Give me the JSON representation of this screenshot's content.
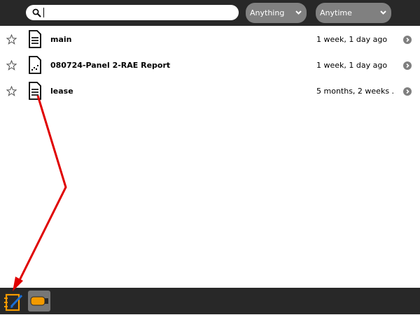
{
  "toolbar": {
    "search": {
      "value": "",
      "placeholder": ""
    },
    "filter_type": {
      "selected": "Anything"
    },
    "filter_time": {
      "selected": "Anytime"
    }
  },
  "journal": {
    "entries": [
      {
        "title": "main",
        "date": "1 week, 1 day ago",
        "icon": "text-document-icon",
        "starred": false
      },
      {
        "title": "080724-Panel 2-RAE Report",
        "date": "1 week, 1 day ago",
        "icon": "chart-document-icon",
        "starred": false
      },
      {
        "title": "lease",
        "date": "5 months, 2 weeks ...",
        "icon": "text-document-icon",
        "starred": false
      }
    ]
  },
  "frame": {
    "items": [
      {
        "name": "journal-icon",
        "color": "#f39a00"
      },
      {
        "name": "usb-drive-icon",
        "color": "#f39a00"
      }
    ]
  },
  "colors": {
    "toolbar_bg": "#282828",
    "dropdown_bg": "#808080",
    "accent_orange": "#f39a00",
    "annotation_red": "#e00000"
  }
}
